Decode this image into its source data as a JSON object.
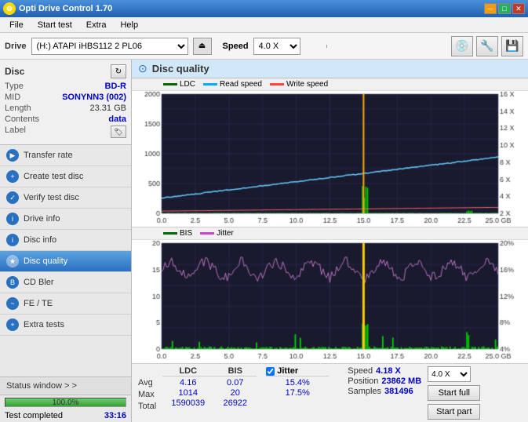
{
  "app": {
    "title": "Opti Drive Control 1.70",
    "icon": "⚙"
  },
  "titlebar": {
    "minimize": "─",
    "maximize": "□",
    "close": "✕"
  },
  "menu": {
    "items": [
      "File",
      "Start test",
      "Extra",
      "Help"
    ]
  },
  "toolbar": {
    "drive_label": "Drive",
    "drive_value": "(H:)  ATAPI iHBS112  2 PL06",
    "speed_label": "Speed",
    "speed_value": "4.0 X"
  },
  "disc": {
    "title": "Disc",
    "type_label": "Type",
    "type_value": "BD-R",
    "mid_label": "MID",
    "mid_value": "SONYNN3 (002)",
    "length_label": "Length",
    "length_value": "23.31 GB",
    "contents_label": "Contents",
    "contents_value": "data",
    "label_label": "Label"
  },
  "nav": {
    "items": [
      {
        "id": "transfer-rate",
        "label": "Transfer rate",
        "active": false
      },
      {
        "id": "create-test-disc",
        "label": "Create test disc",
        "active": false
      },
      {
        "id": "verify-test-disc",
        "label": "Verify test disc",
        "active": false
      },
      {
        "id": "drive-info",
        "label": "Drive info",
        "active": false
      },
      {
        "id": "disc-info",
        "label": "Disc info",
        "active": false
      },
      {
        "id": "disc-quality",
        "label": "Disc quality",
        "active": true
      },
      {
        "id": "cd-bler",
        "label": "CD Bler",
        "active": false
      },
      {
        "id": "fe-te",
        "label": "FE / TE",
        "active": false
      },
      {
        "id": "extra-tests",
        "label": "Extra tests",
        "active": false
      }
    ]
  },
  "chart": {
    "title": "Disc quality",
    "legend_top": [
      {
        "label": "LDC",
        "color": "#006600"
      },
      {
        "label": "Read speed",
        "color": "#00aaff"
      },
      {
        "label": "Write speed",
        "color": "#ff4444"
      }
    ],
    "legend_bottom": [
      {
        "label": "BIS",
        "color": "#006600"
      },
      {
        "label": "Jitter",
        "color": "#cc44cc"
      }
    ],
    "y_top_right": [
      "16 X",
      "14 X",
      "12 X",
      "10 X",
      "8 X",
      "6 X",
      "4 X",
      "2 X"
    ],
    "y_top_left": [
      "2000",
      "1500",
      "1000",
      "500",
      "0"
    ],
    "y_bottom_right": [
      "20%",
      "16%",
      "12%",
      "8%",
      "4%"
    ],
    "y_bottom_left": [
      "20",
      "15",
      "10",
      "5",
      "0"
    ],
    "x_labels": [
      "0.0",
      "2.5",
      "5.0",
      "7.5",
      "10.0",
      "12.5",
      "15.0",
      "17.5",
      "20.0",
      "22.5",
      "25.0 GB"
    ]
  },
  "stats": {
    "ldc_header": "LDC",
    "bis_header": "BIS",
    "jitter_header": "Jitter",
    "avg_label": "Avg",
    "max_label": "Max",
    "total_label": "Total",
    "ldc_avg": "4.16",
    "ldc_max": "1014",
    "ldc_total": "1590039",
    "bis_avg": "0.07",
    "bis_max": "20",
    "bis_total": "26922",
    "jitter_avg": "15.4%",
    "jitter_max": "17.5%",
    "jitter_total": "",
    "speed_label": "Speed",
    "speed_value": "4.18 X",
    "position_label": "Position",
    "position_value": "23862 MB",
    "samples_label": "Samples",
    "samples_value": "381496",
    "speed_select": "4.0 X"
  },
  "status": {
    "window_btn": "Status window > >",
    "test_completed": "Test completed",
    "progress_pct": 100,
    "progress_text": "100.0%",
    "time": "33:16"
  }
}
